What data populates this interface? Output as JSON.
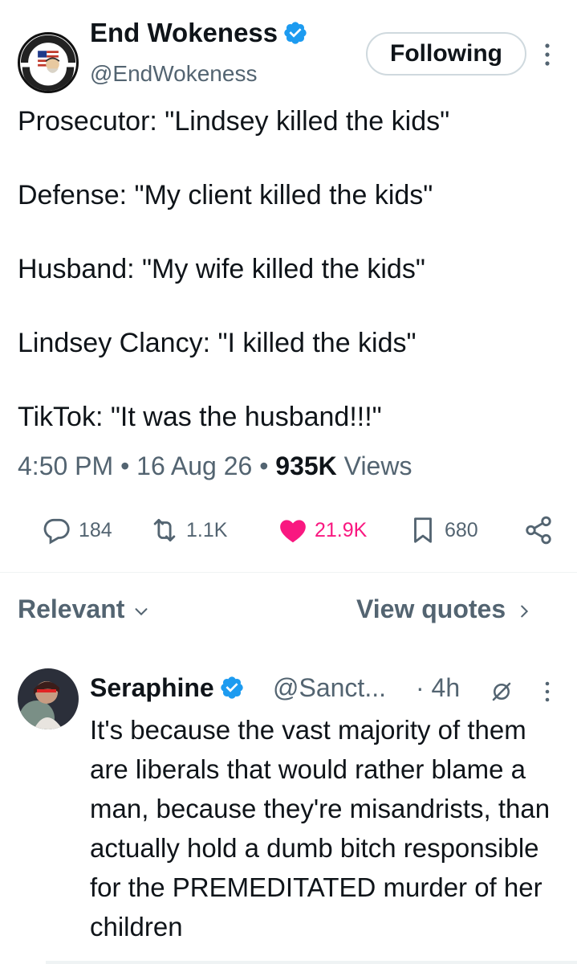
{
  "tweet": {
    "author": {
      "name": "End Wokeness",
      "handle": "@EndWokeness",
      "verified": true,
      "avatar_text_top": "I SUPPORT THE",
      "avatar_text_bottom": "FORMER THINGS"
    },
    "follow_button": "Following",
    "more_icon": "more-vertical-icon",
    "lines": [
      "Prosecutor: \"Lindsey killed the kids\"",
      "Defense: \"My client killed the kids\"",
      "Husband: \"My wife killed the kids\"",
      "Lindsey Clancy: \"I killed the kids\"",
      "TikTok: \"It was the husband!!!\""
    ],
    "meta": {
      "time": "4:50 PM",
      "date": "16 Aug 26",
      "views_count": "935K",
      "views_label": "Views"
    },
    "actions": {
      "replies": "184",
      "reposts": "1.1K",
      "likes": "21.9K",
      "bookmarks": "680"
    }
  },
  "sort": {
    "relevant_label": "Relevant",
    "view_quotes_label": "View quotes"
  },
  "reply": {
    "name": "Seraphine",
    "handle": "@Sanct...",
    "time": "· 4h",
    "text": "It's because the vast majority of them are liberals that would rather blame a man, because they're misandrists, than actually hold a dumb bitch responsible for the PREMEDITATED murder of her children"
  },
  "colors": {
    "verified_blue": "#1d9bf0",
    "like_pink": "#f91880",
    "secondary_text": "#536471"
  }
}
